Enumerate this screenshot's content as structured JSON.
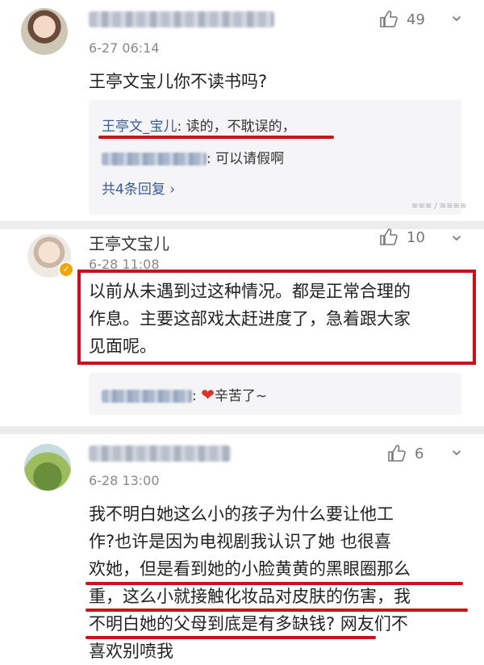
{
  "comments": [
    {
      "name": "",
      "name_blurred": true,
      "time": "6-27 06:14",
      "likes": "49",
      "text": "王亭文宝儿你不读书吗?",
      "replies": [
        {
          "author": "王亭文_宝儿",
          "text": ": 读的，不耽误的，"
        },
        {
          "author": "",
          "author_blurred": true,
          "text": ": 可以请假啊"
        }
      ],
      "reply_count": "共4条回复 ›"
    },
    {
      "name": "王亭文宝儿",
      "time": "6-28 11:08",
      "likes": "10",
      "text_lines": [
        "以前从未遇到过这种情况。都是正常合理的",
        "作息。主要这部戏太赶进度了，急着跟大家",
        "见面呢。"
      ],
      "replies": [
        {
          "author": "",
          "author_blurred": true,
          "text": "辛苦了~",
          "icon": "heart-icon"
        }
      ]
    },
    {
      "name": "",
      "name_blurred": true,
      "time": "6-28 13:00",
      "likes": "6",
      "text_lines": [
        "我不明白她这么小的孩子为什么要让他工",
        "作?也许是因为电视剧我认识了她 也很喜",
        "欢她，但是看到她的小脸黄黄的黑眼圈那么",
        "重，这么小就接触化妆品对皮肤的伤害，我",
        "不明白她的父母到底是有多缺钱? 网友们不",
        "喜欢别喷我"
      ]
    }
  ],
  "colors": {
    "highlight_red": "#c9141c",
    "link_blue": "#3b5b93",
    "reply_bg": "#f5f5f7"
  }
}
